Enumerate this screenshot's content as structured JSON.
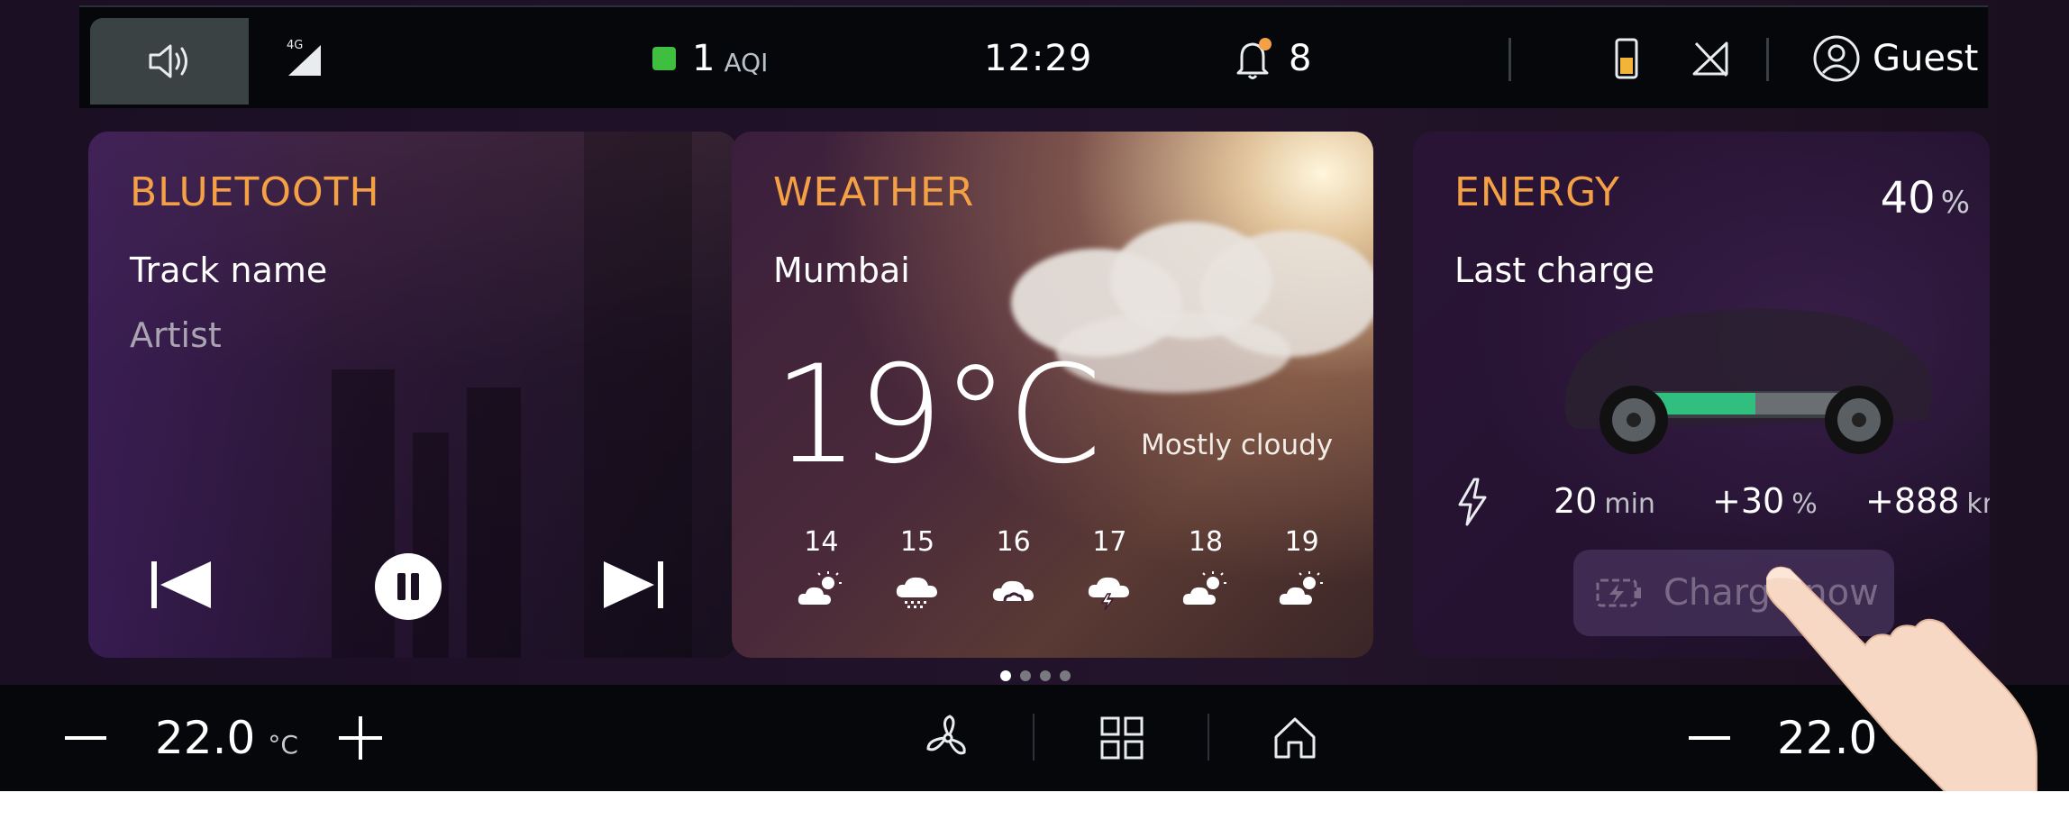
{
  "status_bar": {
    "volume_icon": "speaker-icon",
    "signal_label": "4G",
    "aqi_value": "1",
    "aqi_label": "AQI",
    "aqi_color": "#3fbf3f",
    "time": "12:29",
    "notification_count": "8",
    "user_name": "Guest"
  },
  "bluetooth": {
    "title": "BLUETOOTH",
    "track": "Track name",
    "artist": "Artist"
  },
  "weather": {
    "title": "WEATHER",
    "city": "Mumbai",
    "temperature": "19°C",
    "condition": "Mostly cloudy",
    "forecast": [
      {
        "hour": "14",
        "icon": "partly-sunny-icon"
      },
      {
        "hour": "15",
        "icon": "snow-cloud-icon"
      },
      {
        "hour": "16",
        "icon": "rain-cloud-icon"
      },
      {
        "hour": "17",
        "icon": "thunder-cloud-icon"
      },
      {
        "hour": "18",
        "icon": "partly-sunny-icon"
      },
      {
        "hour": "19",
        "icon": "partly-sunny-icon"
      }
    ]
  },
  "energy": {
    "title": "ENERGY",
    "percent": "40",
    "percent_unit": "%",
    "subtitle": "Last charge",
    "duration": "20",
    "duration_unit": "min",
    "charge_added": "+30",
    "charge_added_unit": "%",
    "range_added": "+888",
    "range_unit": "km",
    "charge_button": "Charge now",
    "accent_color": "#f4a044"
  },
  "pager": {
    "pages": 4,
    "active": 1
  },
  "bottom_bar": {
    "left_temp": "22.0",
    "left_temp_unit": "°C",
    "right_temp": "22.0"
  }
}
